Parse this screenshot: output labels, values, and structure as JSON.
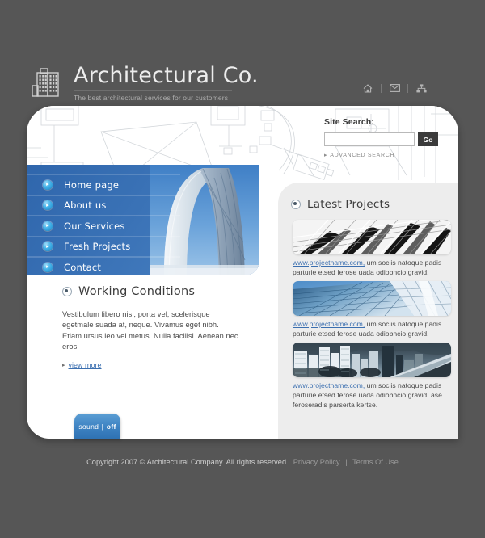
{
  "site": {
    "logo_title": "Architectural Co.",
    "logo_tagline": "The best architectural services for our customers",
    "logo_icon": "building-icon"
  },
  "header": {
    "icons": [
      {
        "name": "home-icon",
        "glyph": "⌂"
      },
      {
        "name": "mail-icon",
        "glyph": "✉"
      },
      {
        "name": "sitemap-icon",
        "glyph": "⛭"
      }
    ]
  },
  "search": {
    "label": "Site Search:",
    "value": "",
    "placeholder": "",
    "go_label": "Go",
    "advanced_label": "ADVANCED SEARCH",
    "advanced_arrow": "▸"
  },
  "nav": {
    "items": [
      {
        "label": "Home page"
      },
      {
        "label": "About us"
      },
      {
        "label": "Our Services"
      },
      {
        "label": "Fresh Projects"
      },
      {
        "label": "Contact"
      }
    ]
  },
  "working_conditions": {
    "title": "Working Conditions",
    "body": "Vestibulum libero nisl, porta vel, scelerisque egetmale suada at, neque. Vivamus eget nibh. Etiam ursus leo vel metus. Nulla facilisi. Aenean nec eros.",
    "more_label": "view more",
    "more_arrow": "▸"
  },
  "latest_projects": {
    "title": "Latest Projects",
    "items": [
      {
        "thumb": "black-white-architecture-photo",
        "link": "www.projectname.com,",
        "text": " um sociis natoque padis parturie etsed ferose uada odiobncio gravid."
      },
      {
        "thumb": "blue-glass-skyscraper-photo",
        "link": "www.projectname.com,",
        "text": " um sociis natoque padis parturie etsed ferose uada odiobncio gravid."
      },
      {
        "thumb": "city-skyline-photo",
        "link": "www.projectname.com,",
        "text": " um sociis natoque padis parturie etsed ferose uada odiobncio gravid. ase feroseradis parserta kertse."
      }
    ]
  },
  "sound_toggle": {
    "label": "sound",
    "separator": "|",
    "state": "off"
  },
  "footer": {
    "copyright": "Copyright 2007 © Architectural Company. All rights reserved.",
    "privacy": "Privacy Policy",
    "separator": "|",
    "terms": "Terms Of Use"
  },
  "colors": {
    "page_bg": "#565656",
    "panel_bg": "#ffffff",
    "accent_blue": "#3b6fb0",
    "nav_blue": "#3a72b6",
    "right_col_bg": "#ededed",
    "go_button": "#3b3b3b"
  }
}
